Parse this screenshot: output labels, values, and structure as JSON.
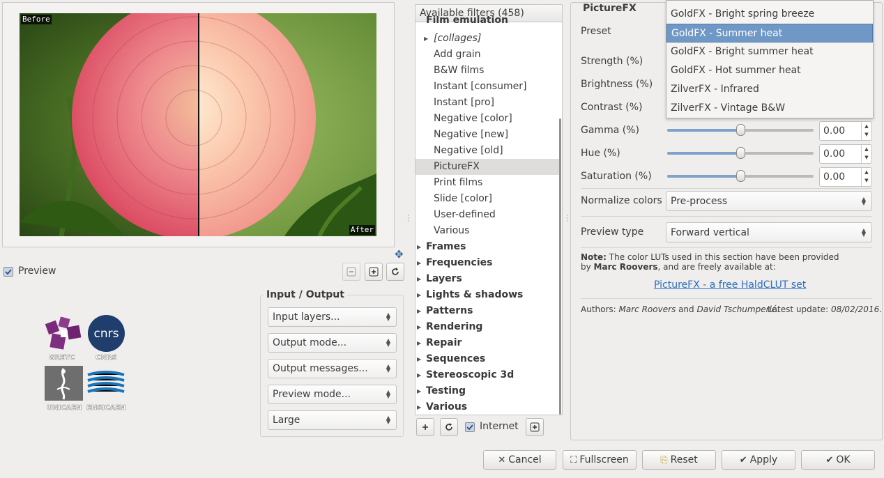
{
  "preview": {
    "before_label": "Before",
    "after_label": "After",
    "checkbox_label": "Preview"
  },
  "logos": {
    "greyc": "GREYC",
    "cnrs_caption": "CNRS",
    "cnrs_mark": "cnrs",
    "unicaen": "UNICAEN",
    "ensicaen": "ENSICAEN"
  },
  "io": {
    "title": "Input / Output",
    "combos": [
      "Input layers...",
      "Output mode...",
      "Output messages...",
      "Preview mode...",
      "Large"
    ]
  },
  "filters": {
    "header": "Available filters (458)",
    "partial_top": "Film emulation",
    "items": [
      {
        "label": "[collages]",
        "arrow": true
      },
      {
        "label": "Add grain"
      },
      {
        "label": "B&W films"
      },
      {
        "label": "Instant [consumer]"
      },
      {
        "label": "Instant [pro]"
      },
      {
        "label": "Negative [color]"
      },
      {
        "label": "Negative [new]"
      },
      {
        "label": "Negative [old]"
      },
      {
        "label": "PictureFX",
        "selected": true
      },
      {
        "label": "Print films"
      },
      {
        "label": "Slide [color]"
      },
      {
        "label": "User-defined"
      },
      {
        "label": "Various"
      }
    ],
    "categories": [
      "Frames",
      "Frequencies",
      "Layers",
      "Lights & shadows",
      "Patterns",
      "Rendering",
      "Repair",
      "Sequences",
      "Stereoscopic 3d",
      "Testing",
      "Various"
    ],
    "internet_label": "Internet"
  },
  "settings": {
    "title": "PictureFX",
    "preset_label": "Preset",
    "strength_label": "Strength (%)",
    "brightness_label": "Brightness (%)",
    "contrast_label": "Contrast (%)",
    "gamma_label": "Gamma (%)",
    "hue_label": "Hue (%)",
    "saturation_label": "Saturation (%)",
    "gamma_value": "0.00",
    "hue_value": "0.00",
    "saturation_value": "0.00",
    "gamma_level": 0.5,
    "hue_level": 0.5,
    "saturation_level": 0.5,
    "normalize_label": "Normalize colors",
    "normalize_value": "Pre-process",
    "preview_type_label": "Preview type",
    "preview_type_value": "Forward vertical",
    "note_bold": "Note:",
    "note_text1": " The color LUTs used in this section have been provided",
    "note_text2_pre": "by ",
    "note_author": "Marc Roovers",
    "note_text2_post": ", and are freely available at:",
    "link_text": "PictureFX - a free HaldCLUT set",
    "authors_pre": "Authors: ",
    "author1": "Marc Roovers",
    "authors_and": " and ",
    "author2": "David Tschumperlé",
    "authors_dot": ".",
    "update_pre": "Latest update: ",
    "update_date": "08/02/2016",
    "update_dot": "."
  },
  "dropdown": {
    "items": [
      {
        "label": "GoldFX - Bright spring breeze"
      },
      {
        "label": "GoldFX - Summer heat",
        "highlighted": true
      },
      {
        "label": "GoldFX - Bright summer heat"
      },
      {
        "label": "GoldFX - Hot summer heat"
      },
      {
        "label": "ZilverFX - Infrared"
      },
      {
        "label": "ZilverFX - Vintage B&W"
      }
    ]
  },
  "buttons": {
    "cancel": "Cancel",
    "fullscreen": "Fullscreen",
    "reset": "Reset",
    "apply": "Apply",
    "ok": "OK"
  },
  "colors": {
    "accent": "#6f98c7",
    "link": "#2a6fbf"
  }
}
